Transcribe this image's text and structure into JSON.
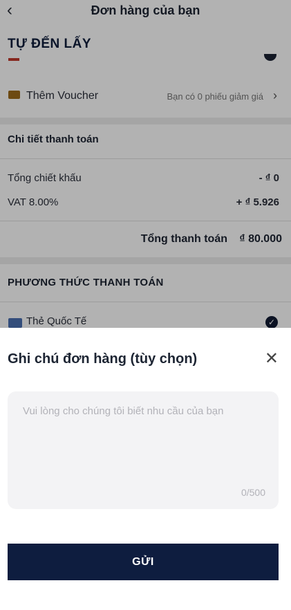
{
  "header": {
    "title": "Đơn hàng của bạn",
    "back_icon": "chevron-left-icon"
  },
  "pickup": {
    "title": "TỰ ĐẾN LẤY"
  },
  "voucher": {
    "icon": "ticket-icon",
    "label": "Thêm Voucher",
    "note": "Bạn có 0 phiếu giảm giá",
    "chevron": "chevron-right-icon"
  },
  "payment_detail": {
    "title": "Chi tiết thanh toán",
    "rows": [
      {
        "label": "Tổng chiết khấu",
        "value": "- ₫ 0"
      },
      {
        "label": "VAT 8.00%",
        "value": "+ ₫ 5.926"
      }
    ],
    "total_label": "Tổng thanh toán",
    "total_value": "₫ 80.000"
  },
  "payment_method": {
    "title": "PHƯƠNG THỨC THANH TOÁN",
    "option": {
      "icon": "credit-card-icon",
      "label": "Thẻ Quốc Tế",
      "selected": true
    }
  },
  "note_sheet": {
    "title": "Ghi chú đơn hàng (tùy chọn)",
    "close_icon": "close-icon",
    "placeholder": "Vui lòng cho chúng tôi biết nhu cầu của bạn",
    "counter": "0/500",
    "submit_label": "GỬI"
  },
  "colors": {
    "primary": "#0e1d3f",
    "overlay": "rgba(0,0,0,0.30)",
    "separator": "#ececec"
  }
}
